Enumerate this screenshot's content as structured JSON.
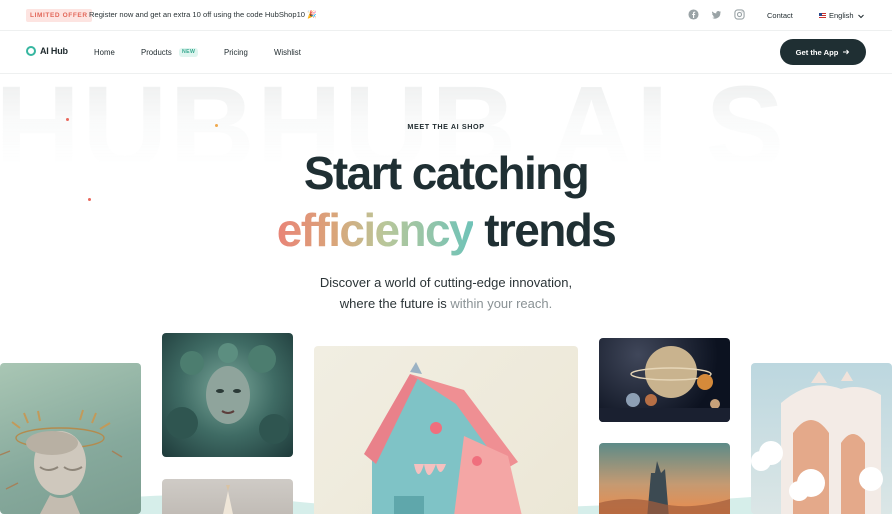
{
  "topbar": {
    "badge": "LIMITED OFFER",
    "promo": "Register now and get an extra 10 off using the code HubShop10 🎉",
    "contact": "Contact",
    "language": "English",
    "social_icons": [
      "facebook-icon",
      "twitter-icon",
      "instagram-icon"
    ]
  },
  "nav": {
    "logo": "AI Hub",
    "links": [
      "Home",
      "Products",
      "Pricing",
      "Wishlist"
    ],
    "new_badge": "NEW",
    "cta": "Get the App"
  },
  "hero": {
    "background_text": "HUBHUB AI S",
    "eyebrow": "MEET THE AI SHOP",
    "title_line1": "Start catching",
    "title_gradient": "efficiency",
    "title_rest": "trends",
    "subtitle_line1": "Discover a world of cutting-edge innovation,",
    "subtitle_line2_strong": "where the future is",
    "subtitle_line2_muted": "within your reach."
  },
  "colors": {
    "brand_dark": "#1f2f33",
    "brand_teal": "#36b6a0",
    "badge_red": "#e2685a",
    "gradient_start": "#e98477",
    "gradient_end": "#6fc3b8"
  },
  "gallery": [
    "greek-statue-image",
    "sea-woman-portrait-image",
    "dessert-image",
    "melting-house-image",
    "planets-image",
    "sunset-castle-image",
    "white-palace-image"
  ]
}
